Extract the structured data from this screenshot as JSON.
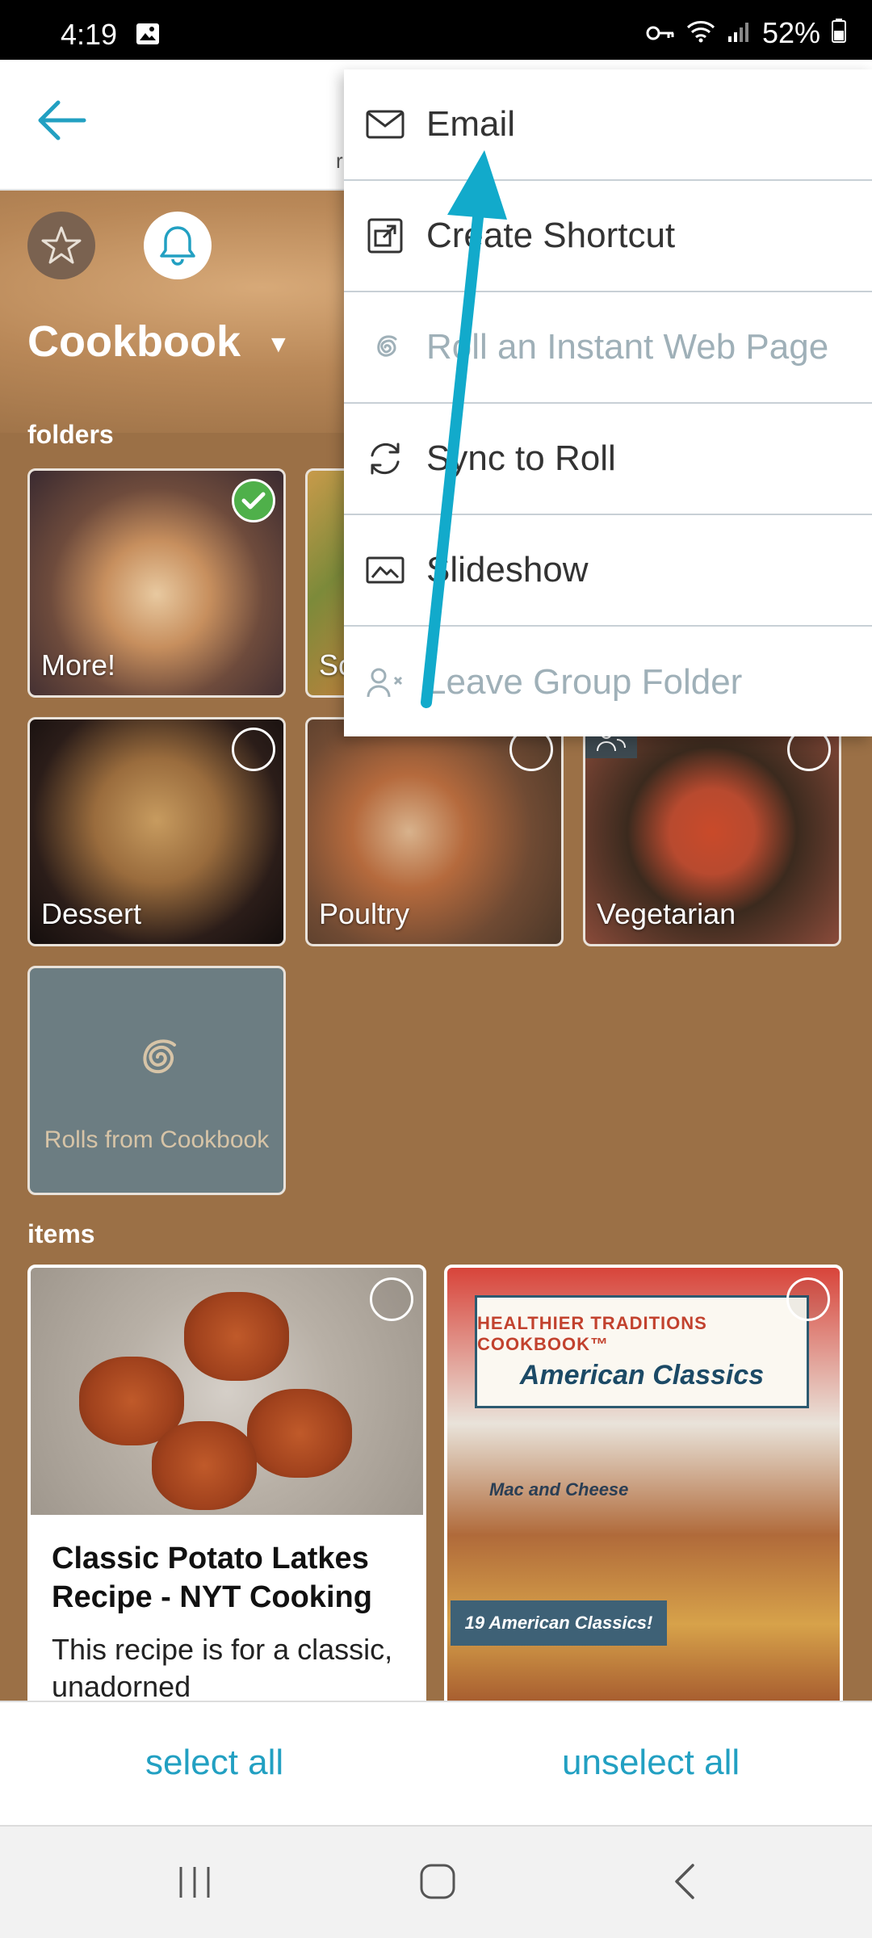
{
  "status": {
    "time": "4:19",
    "battery": "52%"
  },
  "folder": {
    "name": "Cookbook",
    "folders_label": "folders",
    "items_label": "items"
  },
  "folders": [
    {
      "label": "More!",
      "checked": true
    },
    {
      "label": "So"
    },
    {
      "label": "Dessert"
    },
    {
      "label": "Poultry"
    },
    {
      "label": "Vegetarian"
    },
    {
      "label": "Rolls from Cookbook"
    }
  ],
  "items": [
    {
      "title": "Classic Potato Latkes Recipe - NYT Cooking",
      "desc": "This recipe is for a classic, unadorned"
    },
    {
      "banner_top": "HEALTHIER TRADITIONS COOKBOOK™",
      "banner_main": "American Classics",
      "photo_label": "Mac and Cheese",
      "tag": "19 American Classics!"
    }
  ],
  "menu": {
    "items": [
      {
        "label": "Email",
        "icon": "mail-icon",
        "enabled": true
      },
      {
        "label": "Create Shortcut",
        "icon": "shortcut-icon",
        "enabled": true
      },
      {
        "label": "Roll an Instant Web Page",
        "icon": "spiral-icon",
        "enabled": false
      },
      {
        "label": "Sync to Roll",
        "icon": "sync-icon",
        "enabled": true
      },
      {
        "label": "Slideshow",
        "icon": "slideshow-icon",
        "enabled": true
      },
      {
        "label": "Leave Group Folder",
        "icon": "leave-group-icon",
        "enabled": false
      }
    ]
  },
  "bottom": {
    "select_all": "select all",
    "unselect_all": "unselect all"
  },
  "header_partial": "r",
  "colors": {
    "accent": "#22a0c2",
    "background": "#9b7046",
    "check_green": "#4fb04a"
  }
}
